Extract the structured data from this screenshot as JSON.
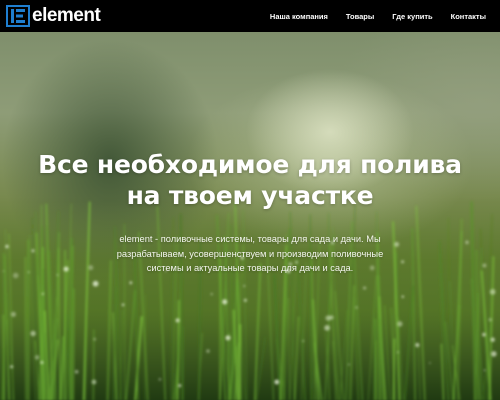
{
  "brand": {
    "name": "element",
    "logo_icon": "element-logo-icon",
    "colors": {
      "accent": "#1f7fd0",
      "navbar_bg": "#000000"
    }
  },
  "nav": {
    "items": [
      {
        "label": "Наша компания"
      },
      {
        "label": "Товары"
      },
      {
        "label": "Где купить"
      },
      {
        "label": "Контакты"
      }
    ]
  },
  "hero": {
    "headline": "Все необходимое для полива на твоем участке",
    "subtitle": "element - поливочные системы, товары для сада и дачи. Мы разрабатываем, усовершенствуем и производим поливочные системы и актуальные товары для дачи и сада.",
    "background": "blurred-green-grass-photo"
  }
}
